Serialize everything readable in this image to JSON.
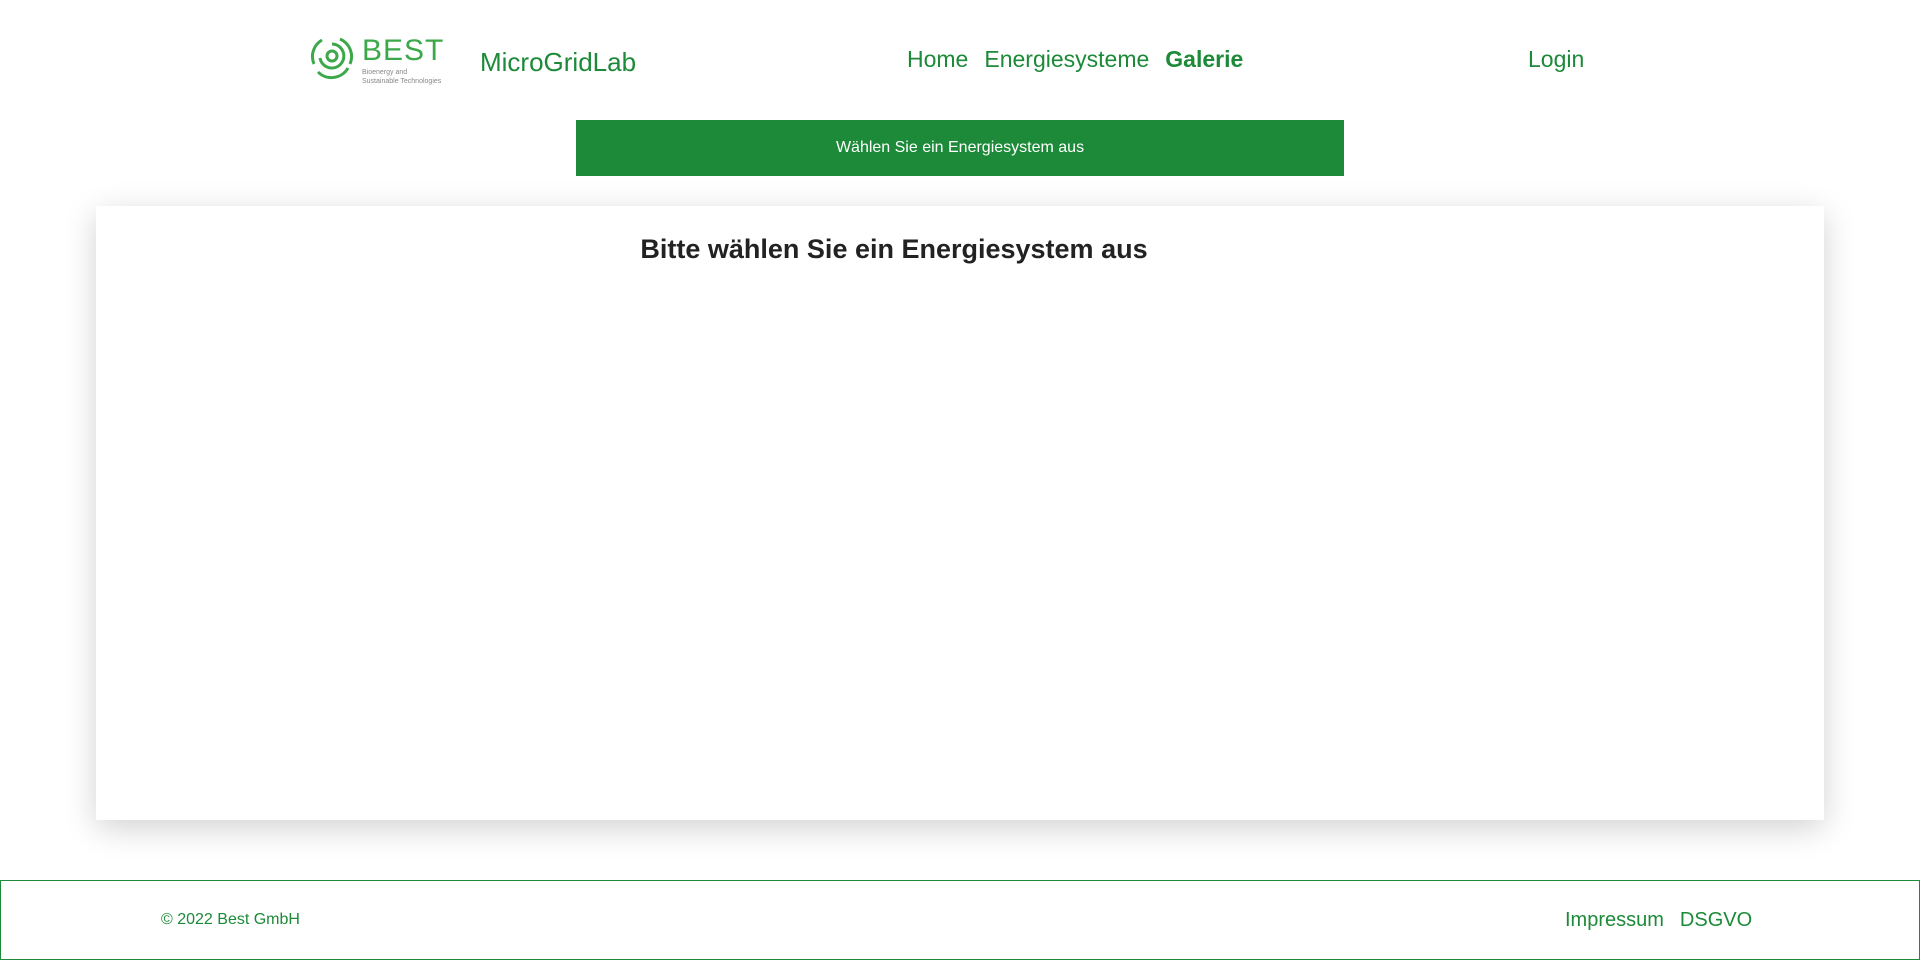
{
  "header": {
    "logo_text": "BEST",
    "logo_tagline": "Bioenergy and Sustainable Technologies",
    "brand_name": "MicroGridLab",
    "nav": {
      "home": "Home",
      "energy_systems": "Energiesysteme",
      "gallery": "Galerie"
    },
    "login": "Login"
  },
  "main": {
    "select_button_label": "Wählen Sie ein Energiesystem aus",
    "card_title": "Bitte wählen Sie ein Energiesystem aus"
  },
  "footer": {
    "copyright": "© 2022 Best GmbH",
    "links": {
      "imprint": "Impressum",
      "privacy": "DSGVO"
    }
  },
  "colors": {
    "brand_green": "#1c8a38",
    "title_text": "#222222"
  }
}
